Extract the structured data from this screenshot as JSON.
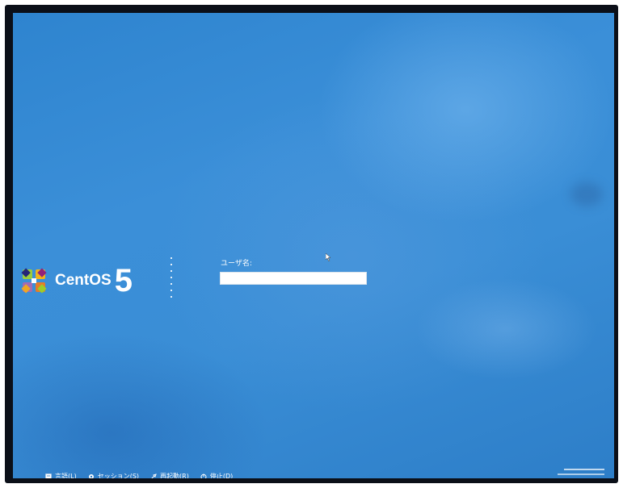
{
  "login": {
    "username_label": "ユーザ名:",
    "username_value": "",
    "username_placeholder": ""
  },
  "brand": {
    "name": "CentOS",
    "version": "5"
  },
  "bottom_bar": {
    "items": [
      {
        "label": "言語(L)",
        "icon": "language-icon"
      },
      {
        "label": "セッション(S)",
        "icon": "session-icon"
      },
      {
        "label": "再起動(R)",
        "icon": "restart-icon"
      },
      {
        "label": "停止(D)",
        "icon": "shutdown-icon"
      }
    ]
  },
  "colors": {
    "background": "#3a8ed6",
    "text": "#ffffff"
  }
}
